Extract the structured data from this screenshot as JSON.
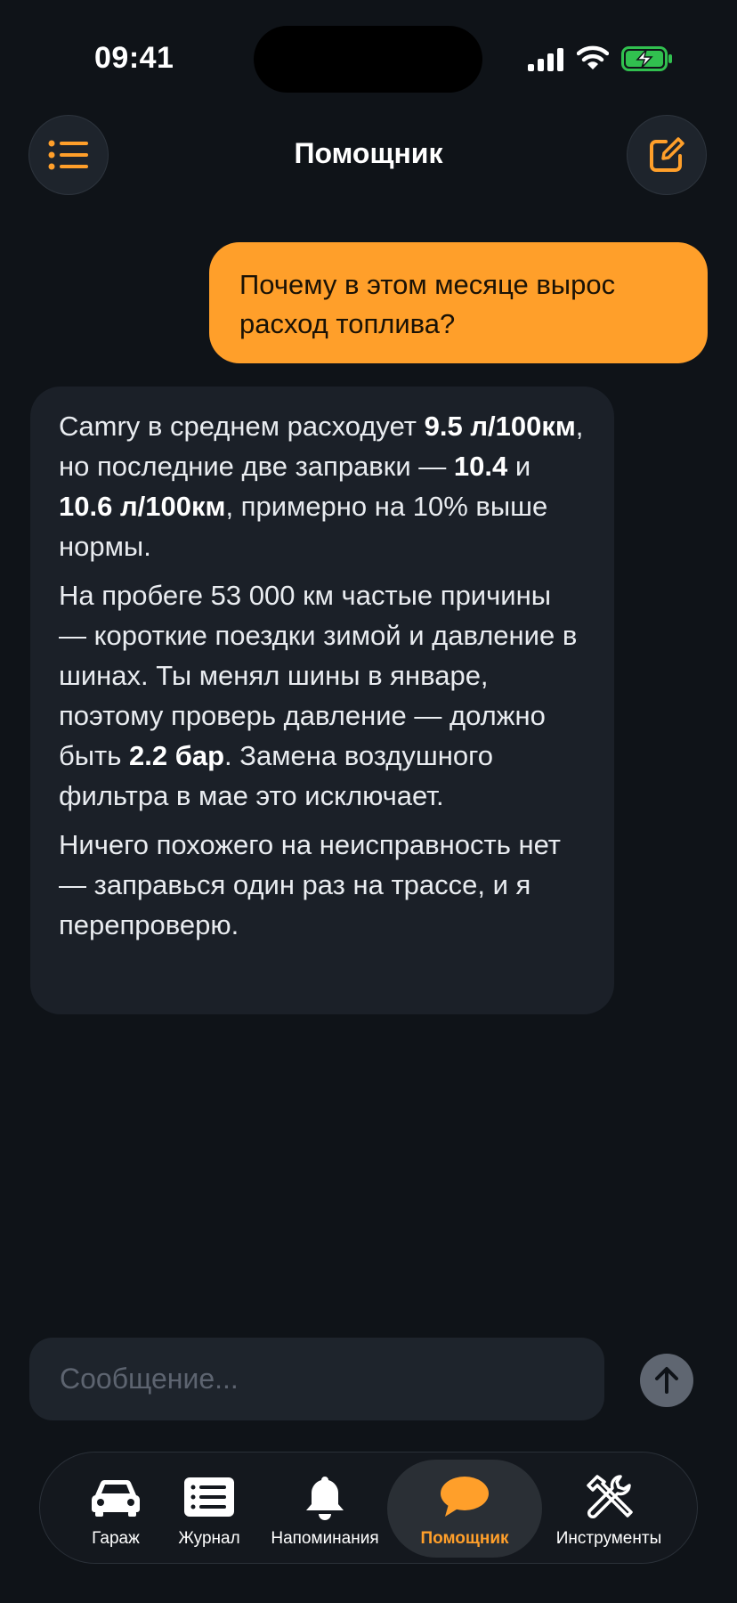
{
  "status_bar": {
    "time": "09:41"
  },
  "header": {
    "title": "Помощник"
  },
  "conversation": {
    "user_message": "Почему в этом месяце вырос расход топлива?",
    "assistant": {
      "p1": {
        "t1": "Camry в среднем расходует ",
        "b1": "9.5 л/100км",
        "t2": ", но последние две заправки — ",
        "b2": "10.4",
        "t3": " и ",
        "b3": "10.6 л/100км",
        "t4": ", примерно на 10% выше нормы."
      },
      "p2": {
        "t1": "На пробеге 53 000 км частые причины — короткие поездки зимой и давление в шинах. Ты менял шины в январе, поэтому проверь давление — должно быть ",
        "b1": "2.2 бар",
        "t2": ". Замена воздушного фильтра в мае это исключает."
      },
      "p3": "Ничего похожего на неисправность нет — заправься один раз на трассе, и я перепроверю."
    }
  },
  "composer": {
    "placeholder": "Сообщение..."
  },
  "tabbar": {
    "tabs": [
      {
        "label": "Гараж",
        "icon": "car-icon"
      },
      {
        "label": "Журнал",
        "icon": "list-icon"
      },
      {
        "label": "Напоминания",
        "icon": "bell-icon"
      },
      {
        "label": "Помощник",
        "icon": "chat-bubble-icon",
        "active": true
      },
      {
        "label": "Инструменты",
        "icon": "tools-icon"
      }
    ]
  },
  "colors": {
    "accent": "#ff9f2a",
    "background": "#0f1318",
    "bubble": "#1b2028"
  }
}
